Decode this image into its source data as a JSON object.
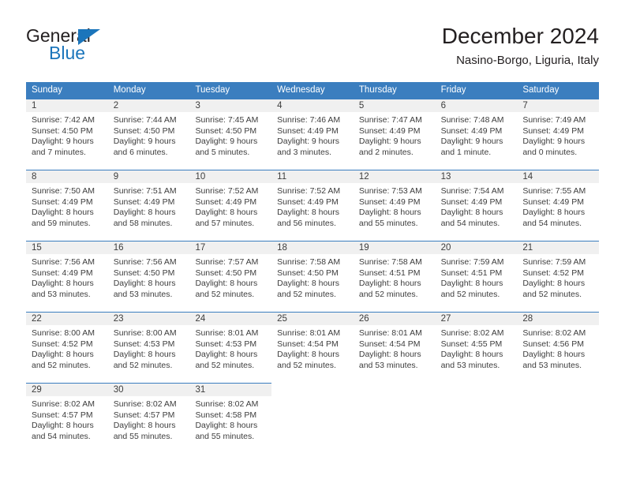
{
  "brand": {
    "name_top": "General",
    "name_bottom": "Blue",
    "triangle_color": "#1b75bb",
    "text_color": "#231f20"
  },
  "header": {
    "title": "December 2024",
    "subtitle": "Nasino-Borgo, Liguria, Italy"
  },
  "theme": {
    "header_row_bg": "#3b7ebf",
    "header_row_text": "#ffffff",
    "daynum_band_bg": "#f0f0f0",
    "cell_text": "#3d3d3d",
    "page_bg": "#ffffff"
  },
  "weekdays": [
    "Sunday",
    "Monday",
    "Tuesday",
    "Wednesday",
    "Thursday",
    "Friday",
    "Saturday"
  ],
  "weeks": [
    [
      {
        "day": "1",
        "sunrise": "Sunrise: 7:42 AM",
        "sunset": "Sunset: 4:50 PM",
        "daylight1": "Daylight: 9 hours",
        "daylight2": "and 7 minutes."
      },
      {
        "day": "2",
        "sunrise": "Sunrise: 7:44 AM",
        "sunset": "Sunset: 4:50 PM",
        "daylight1": "Daylight: 9 hours",
        "daylight2": "and 6 minutes."
      },
      {
        "day": "3",
        "sunrise": "Sunrise: 7:45 AM",
        "sunset": "Sunset: 4:50 PM",
        "daylight1": "Daylight: 9 hours",
        "daylight2": "and 5 minutes."
      },
      {
        "day": "4",
        "sunrise": "Sunrise: 7:46 AM",
        "sunset": "Sunset: 4:49 PM",
        "daylight1": "Daylight: 9 hours",
        "daylight2": "and 3 minutes."
      },
      {
        "day": "5",
        "sunrise": "Sunrise: 7:47 AM",
        "sunset": "Sunset: 4:49 PM",
        "daylight1": "Daylight: 9 hours",
        "daylight2": "and 2 minutes."
      },
      {
        "day": "6",
        "sunrise": "Sunrise: 7:48 AM",
        "sunset": "Sunset: 4:49 PM",
        "daylight1": "Daylight: 9 hours",
        "daylight2": "and 1 minute."
      },
      {
        "day": "7",
        "sunrise": "Sunrise: 7:49 AM",
        "sunset": "Sunset: 4:49 PM",
        "daylight1": "Daylight: 9 hours",
        "daylight2": "and 0 minutes."
      }
    ],
    [
      {
        "day": "8",
        "sunrise": "Sunrise: 7:50 AM",
        "sunset": "Sunset: 4:49 PM",
        "daylight1": "Daylight: 8 hours",
        "daylight2": "and 59 minutes."
      },
      {
        "day": "9",
        "sunrise": "Sunrise: 7:51 AM",
        "sunset": "Sunset: 4:49 PM",
        "daylight1": "Daylight: 8 hours",
        "daylight2": "and 58 minutes."
      },
      {
        "day": "10",
        "sunrise": "Sunrise: 7:52 AM",
        "sunset": "Sunset: 4:49 PM",
        "daylight1": "Daylight: 8 hours",
        "daylight2": "and 57 minutes."
      },
      {
        "day": "11",
        "sunrise": "Sunrise: 7:52 AM",
        "sunset": "Sunset: 4:49 PM",
        "daylight1": "Daylight: 8 hours",
        "daylight2": "and 56 minutes."
      },
      {
        "day": "12",
        "sunrise": "Sunrise: 7:53 AM",
        "sunset": "Sunset: 4:49 PM",
        "daylight1": "Daylight: 8 hours",
        "daylight2": "and 55 minutes."
      },
      {
        "day": "13",
        "sunrise": "Sunrise: 7:54 AM",
        "sunset": "Sunset: 4:49 PM",
        "daylight1": "Daylight: 8 hours",
        "daylight2": "and 54 minutes."
      },
      {
        "day": "14",
        "sunrise": "Sunrise: 7:55 AM",
        "sunset": "Sunset: 4:49 PM",
        "daylight1": "Daylight: 8 hours",
        "daylight2": "and 54 minutes."
      }
    ],
    [
      {
        "day": "15",
        "sunrise": "Sunrise: 7:56 AM",
        "sunset": "Sunset: 4:49 PM",
        "daylight1": "Daylight: 8 hours",
        "daylight2": "and 53 minutes."
      },
      {
        "day": "16",
        "sunrise": "Sunrise: 7:56 AM",
        "sunset": "Sunset: 4:50 PM",
        "daylight1": "Daylight: 8 hours",
        "daylight2": "and 53 minutes."
      },
      {
        "day": "17",
        "sunrise": "Sunrise: 7:57 AM",
        "sunset": "Sunset: 4:50 PM",
        "daylight1": "Daylight: 8 hours",
        "daylight2": "and 52 minutes."
      },
      {
        "day": "18",
        "sunrise": "Sunrise: 7:58 AM",
        "sunset": "Sunset: 4:50 PM",
        "daylight1": "Daylight: 8 hours",
        "daylight2": "and 52 minutes."
      },
      {
        "day": "19",
        "sunrise": "Sunrise: 7:58 AM",
        "sunset": "Sunset: 4:51 PM",
        "daylight1": "Daylight: 8 hours",
        "daylight2": "and 52 minutes."
      },
      {
        "day": "20",
        "sunrise": "Sunrise: 7:59 AM",
        "sunset": "Sunset: 4:51 PM",
        "daylight1": "Daylight: 8 hours",
        "daylight2": "and 52 minutes."
      },
      {
        "day": "21",
        "sunrise": "Sunrise: 7:59 AM",
        "sunset": "Sunset: 4:52 PM",
        "daylight1": "Daylight: 8 hours",
        "daylight2": "and 52 minutes."
      }
    ],
    [
      {
        "day": "22",
        "sunrise": "Sunrise: 8:00 AM",
        "sunset": "Sunset: 4:52 PM",
        "daylight1": "Daylight: 8 hours",
        "daylight2": "and 52 minutes."
      },
      {
        "day": "23",
        "sunrise": "Sunrise: 8:00 AM",
        "sunset": "Sunset: 4:53 PM",
        "daylight1": "Daylight: 8 hours",
        "daylight2": "and 52 minutes."
      },
      {
        "day": "24",
        "sunrise": "Sunrise: 8:01 AM",
        "sunset": "Sunset: 4:53 PM",
        "daylight1": "Daylight: 8 hours",
        "daylight2": "and 52 minutes."
      },
      {
        "day": "25",
        "sunrise": "Sunrise: 8:01 AM",
        "sunset": "Sunset: 4:54 PM",
        "daylight1": "Daylight: 8 hours",
        "daylight2": "and 52 minutes."
      },
      {
        "day": "26",
        "sunrise": "Sunrise: 8:01 AM",
        "sunset": "Sunset: 4:54 PM",
        "daylight1": "Daylight: 8 hours",
        "daylight2": "and 53 minutes."
      },
      {
        "day": "27",
        "sunrise": "Sunrise: 8:02 AM",
        "sunset": "Sunset: 4:55 PM",
        "daylight1": "Daylight: 8 hours",
        "daylight2": "and 53 minutes."
      },
      {
        "day": "28",
        "sunrise": "Sunrise: 8:02 AM",
        "sunset": "Sunset: 4:56 PM",
        "daylight1": "Daylight: 8 hours",
        "daylight2": "and 53 minutes."
      }
    ],
    [
      {
        "day": "29",
        "sunrise": "Sunrise: 8:02 AM",
        "sunset": "Sunset: 4:57 PM",
        "daylight1": "Daylight: 8 hours",
        "daylight2": "and 54 minutes."
      },
      {
        "day": "30",
        "sunrise": "Sunrise: 8:02 AM",
        "sunset": "Sunset: 4:57 PM",
        "daylight1": "Daylight: 8 hours",
        "daylight2": "and 55 minutes."
      },
      {
        "day": "31",
        "sunrise": "Sunrise: 8:02 AM",
        "sunset": "Sunset: 4:58 PM",
        "daylight1": "Daylight: 8 hours",
        "daylight2": "and 55 minutes."
      },
      {
        "day": "",
        "sunrise": "",
        "sunset": "",
        "daylight1": "",
        "daylight2": ""
      },
      {
        "day": "",
        "sunrise": "",
        "sunset": "",
        "daylight1": "",
        "daylight2": ""
      },
      {
        "day": "",
        "sunrise": "",
        "sunset": "",
        "daylight1": "",
        "daylight2": ""
      },
      {
        "day": "",
        "sunrise": "",
        "sunset": "",
        "daylight1": "",
        "daylight2": ""
      }
    ]
  ]
}
